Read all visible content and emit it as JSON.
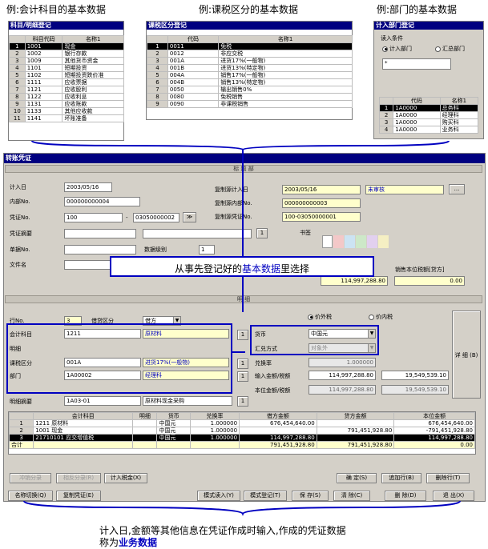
{
  "captions": {
    "top1": "例:会计科目的基本数据",
    "top2": "例:课税区分的基本数据",
    "top3": "例:部门的基本数据",
    "callout": "从事先登记好的基本数据里选择",
    "callout_pre": "从事先登记好的",
    "callout_hl": "基本数据",
    "callout_post": "里选择",
    "bottom_line1": "计入日,金额等其他信息在凭证作成时输入,作成的凭证数据",
    "bottom_line2_pre": "称为",
    "bottom_line2_hl": "业务数据"
  },
  "colors": {
    "blue_box": "#0000c0",
    "titlebar": "#000080",
    "yellow": "#ffffcc",
    "gray": "#d4d0c8"
  },
  "account_panel": {
    "title": "科目/明细登记",
    "headers": [
      "",
      "科目代码",
      "名称1"
    ],
    "rows": [
      [
        "1",
        "1001",
        "现金"
      ],
      [
        "2",
        "1002",
        "银行存款"
      ],
      [
        "3",
        "1009",
        "其他货币资金"
      ],
      [
        "4",
        "1101",
        "短期投资"
      ],
      [
        "5",
        "1102",
        "短期投资跌价准"
      ],
      [
        "6",
        "1111",
        "应收票据"
      ],
      [
        "7",
        "1121",
        "应收股利"
      ],
      [
        "8",
        "1122",
        "应收利息"
      ],
      [
        "9",
        "1131",
        "应收账款"
      ],
      [
        "10",
        "1133",
        "其他应收款"
      ],
      [
        "11",
        "1141",
        "坏账准备"
      ]
    ]
  },
  "tax_panel": {
    "title": "课税区分登记",
    "headers": [
      "",
      "代码",
      "名称1"
    ],
    "rows": [
      [
        "1",
        "0011",
        "免税"
      ],
      [
        "2",
        "0012",
        "非应交税"
      ],
      [
        "3",
        "001A",
        "进货17%(一般物)"
      ],
      [
        "4",
        "001B",
        "进货13%(特定物)"
      ],
      [
        "5",
        "004A",
        "销售17%(一般物)"
      ],
      [
        "6",
        "004B",
        "销售13%(特定物)"
      ],
      [
        "7",
        "0050",
        "输出销售0%"
      ],
      [
        "8",
        "0080",
        "免税销售"
      ],
      [
        "9",
        "0090",
        "非课税销售"
      ]
    ]
  },
  "dept_panel": {
    "title": "计入部门登记",
    "read_cond": "读入条件",
    "opt1": "计入部门",
    "opt2": "汇总部门",
    "search_value": "*",
    "headers": [
      "",
      "代码",
      "名称1"
    ],
    "rows": [
      [
        "1",
        "1A0000",
        "总务科"
      ],
      [
        "2",
        "1A0000",
        "经理科"
      ],
      [
        "3",
        "1A0000",
        "购买科"
      ],
      [
        "4",
        "1A0000",
        "业务科"
      ]
    ]
  },
  "form": {
    "title": "转账凭证",
    "header_sec": "标 题 部",
    "date_label": "计入日",
    "date_value": "2003/05/16",
    "internal_label": "内部No.",
    "internal_value": "000000000004",
    "voucher_label": "凭证No.",
    "voucher_from": "100",
    "voucher_sep": "-",
    "voucher_to": "03050000002",
    "voucher_btn": "≫",
    "summary_label": "凭证摘要",
    "summary_btn": "1",
    "docs_label": "单据No.",
    "level_label": "数据级别",
    "level_value": "1",
    "filename_label": "文件名",
    "copy_date_label": "复制源计入日",
    "copy_date_value": "2003/05/16",
    "copy_status": "未审核",
    "copy_btn": "...",
    "copy_internal_label": "复制源内部No.",
    "copy_internal_value": "000000000003",
    "copy_voucher_label": "复制源凭证No.",
    "copy_voucher_value": "100-03050000001",
    "sticker_label": "书签",
    "sales_label": "销售本位税额[贷方]",
    "left_amount": "114,997,288.80",
    "right_amount": "0.00",
    "detail_sec": "明 细",
    "row_label": "行No.",
    "row_value": "3",
    "dc_label": "借贷区分",
    "dc_value": "借方",
    "tax_excl": "价外税",
    "tax_incl": "价内税",
    "acct_label": "会计科目",
    "acct_code": "1211",
    "acct_name": "原材料",
    "acct_btn": "1",
    "detail_label": "明细",
    "taxcls_label": "课税区分",
    "taxcls_code": "001A",
    "taxcls_name": "进货17%(一般物)",
    "taxcls_btn": "1",
    "dept_label": "部门",
    "dept_code": "1A00002",
    "dept_name": "经理科",
    "dept_btn": "1",
    "currency_label": "货币",
    "currency_value": "中国元",
    "exmethod_label": "汇兑方式",
    "exmethod_value": "对象外",
    "rate_label": "兑换率",
    "rate_value": "1.000000",
    "input_amt_label": "输入金额/税额",
    "input_amt": "114,997,288.80",
    "input_tax": "19,549,539.10",
    "base_amt_label": "本位金额/税额",
    "base_amt": "114,997,288.80",
    "base_tax": "19,549,539.10",
    "detail_btn": "详 细 (B)",
    "memo_label": "明细摘要",
    "memo_code": "1A03-01",
    "memo_text": "原材料现金采购",
    "memo_btn": "1",
    "grid_headers": [
      "",
      "会计科目",
      "明细",
      "货币",
      "兑换率",
      "借方金额",
      "贷方金额",
      "本位金额"
    ],
    "grid_rows": [
      [
        "1",
        "1211  原材料",
        "",
        "中国元",
        "1.000000",
        "676,454,640.00",
        "",
        "676,454,640.00"
      ],
      [
        "2",
        "1001  现金",
        "",
        "中国元",
        "1.000000",
        "",
        "791,451,928.80",
        "-791,451,928.80"
      ],
      [
        "3",
        "21710101  应交增值税",
        "",
        "中国元",
        "1.000000",
        "114,997,288.80",
        "",
        "114,997,288.80"
      ]
    ],
    "total_label": "合计",
    "total_debit": "791,451,928.80",
    "total_credit": "791,451,928.80",
    "total_base": "0.00",
    "btn_offset": "冲销分录",
    "btn_reverse": "相反分录(R)",
    "btn_taxin": "计入税金(X)",
    "btn_confirm": "确 定(S)",
    "btn_addrow": "追加行(B)",
    "btn_delrow": "删除行(T)",
    "btn_rename": "名称切换(Q)",
    "btn_copy": "复制凭证(E)",
    "btn_template": "模式读入(Y)",
    "btn_tplreg": "模式登记(T)",
    "btn_save": "保 存(S)",
    "btn_clear": "清 除(C)",
    "btn_delete": "删 除(D)",
    "btn_exit": "退 出(X)"
  }
}
